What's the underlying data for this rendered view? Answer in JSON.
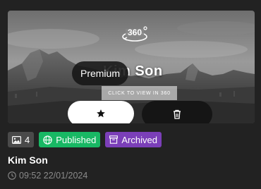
{
  "card": {
    "title": "Kim Son",
    "overlay_title": "Kim Son",
    "premium_label": "Premium",
    "view_hint": "CLICK TO VIEW IN 360",
    "badge_text": "360",
    "favorite_icon": "star-icon",
    "delete_icon": "trash-icon",
    "tags": {
      "image_count": "4",
      "published": "Published",
      "archived": "Archived"
    },
    "datetime": "09:52 22/01/2024"
  },
  "colors": {
    "background": "#222222",
    "published": "#18b864",
    "archived": "#7b3fb8",
    "count_tag": "#4a4a4a"
  }
}
